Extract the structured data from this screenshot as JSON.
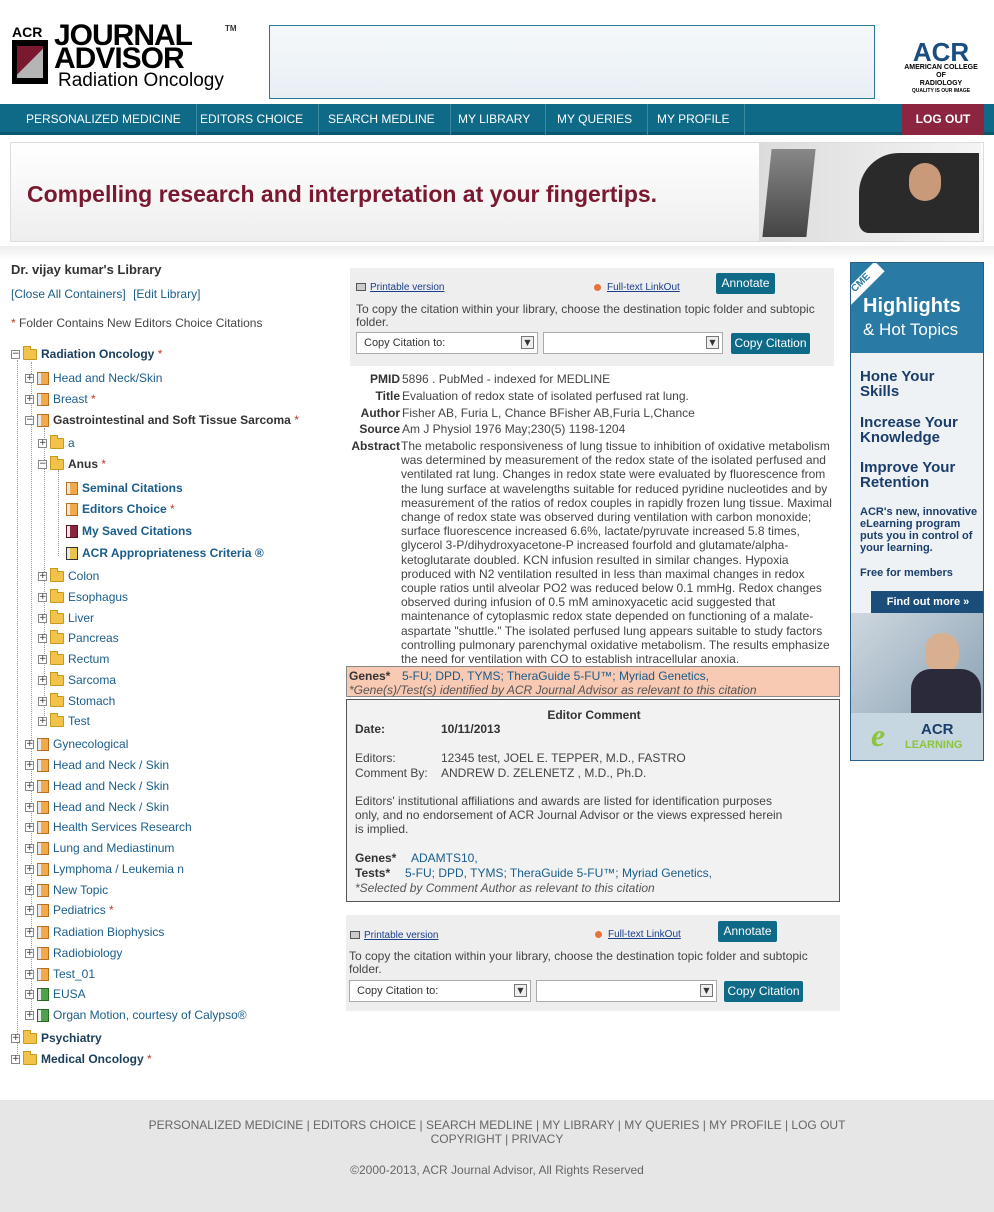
{
  "header": {
    "logo_acr": "ACR",
    "logo_line1": "JOURNAL",
    "logo_line2": "ADVISOR",
    "logo_tm": "TM",
    "logo_sub": "Radiation Oncology",
    "brand_big": "ACR",
    "brand_small_1": "AMERICAN COLLEGE OF",
    "brand_small_2": "RADIOLOGY",
    "brand_small_3": "QUALITY IS OUR IMAGE"
  },
  "nav": {
    "items": [
      "PERSONALIZED MEDICINE",
      "EDITORS CHOICE",
      "SEARCH MEDLINE",
      "MY LIBRARY",
      "MY QUERIES",
      "MY PROFILE"
    ],
    "logout": "LOG OUT"
  },
  "hero": {
    "text": "Compelling research and interpretation at your fingertips."
  },
  "library": {
    "title": "Dr. vijay kumar's Library",
    "close_all": "[Close All Containers]",
    "edit": "[Edit Library]",
    "note": "Folder Contains New Editors Choice Citations",
    "star": "*",
    "tree": {
      "root": "Radiation Oncology",
      "head_neck_skin": "Head and Neck/Skin",
      "breast": "Breast",
      "gi": "Gastrointestinal and Soft Tissue Sarcoma",
      "a": "a",
      "anus": "Anus",
      "seminal": "Seminal Citations",
      "editors_choice": "Editors Choice",
      "saved": "My Saved Citations",
      "acr_criteria": "ACR Appropriateness Criteria ®",
      "colon": "Colon",
      "esophagus": "Esophagus",
      "liver": "Liver",
      "pancreas": "Pancreas",
      "rectum": "Rectum",
      "sarcoma": "Sarcoma",
      "stomach": "Stomach",
      "test": "Test",
      "gynecological": "Gynecological",
      "hn1": "Head and Neck / Skin",
      "hn2": "Head and Neck / Skin",
      "hn3": "Head and Neck / Skin",
      "hsr": "Health Services Research",
      "lung": "Lung and Mediastinum",
      "lymphoma": "Lymphoma / Leukemia n",
      "new_topic": "New Topic",
      "pediatrics": "Pediatrics",
      "rad_bio_phys": "Radiation Biophysics",
      "radiobiology": "Radiobiology",
      "test01": "Test_01",
      "eusa": "EUSA",
      "organ_motion": "Organ Motion, courtesy of Calypso®",
      "psychiatry": "Psychiatry",
      "med_onc": "Medical Oncology"
    }
  },
  "citation": {
    "printable": "Printable version",
    "fulltext": "Full-text LinkOut",
    "annotate": "Annotate",
    "copy_instruction": "To copy the citation within your library, choose the destination topic folder and subtopic folder.",
    "copy_to": "Copy Citation to:",
    "copy_button": "Copy Citation",
    "pmid_label": "PMID",
    "pmid": "5896 . PubMed - indexed for MEDLINE",
    "title_label": "Title",
    "title": "Evaluation of redox state of isolated perfused rat lung.",
    "author_label": "Author",
    "author": "Fisher AB, Furia L, Chance BFisher AB,Furia L,Chance",
    "source_label": "Source",
    "source": "Am J Physiol 1976 May;230(5) 1198-1204",
    "abstract_label": "Abstract",
    "abstract": "The metabolic responsiveness of lung tissue to inhibition of oxidative metabolism was determined by measurement of the redox state of the isolated perfused and ventilated rat lung. Changes in redox state were evaluated by fluorescence from the lung surface at wavelengths suitable for reduced pyridine nucleotides and by measurement of the ratios of redox couples in rapidly frozen lung tissue. Maximal change of redox state was observed during ventilation with carbon monoxide; surface fluorescence increased 6.6%, lactate/pyruvate increased 5.8 times, glycerol 3-P/dihydroxyacetone-P increased fourfold and glutamate/alpha-ketoglutarate doubled. KCN infusion resulted in similar changes. Hypoxia produced with N2 ventilation resulted in less than maximal changes in redox couple ratios until alveolar PO2 was reduced below 0.1 mmHg. Redox changes observed during infusion of 0.5 mM aminoxyacetic acid suggested that maintenance of cytoplasmic redox state depended on functioning of a malate-aspartate \"shuttle.\" The isolated perfused lung appears suitable to study factors controlling pulmonary parenchymal oxidative metabolism. The results emphasize the need for ventilation with CO to establish intracellular anoxia.",
    "genes_label": "Genes*",
    "genes": "5-FU; DPD, TYMS; TheraGuide 5-FU™; Myriad Genetics,",
    "genes_note": "*Gene(s)/Test(s) identified by ACR Journal Advisor as relevant to this citation"
  },
  "editor_comment": {
    "title": "Editor Comment",
    "date_label": "Date:",
    "date": "10/11/2013",
    "editors_label": "Editors:",
    "editors": "12345 test, JOEL E. TEPPER, M.D., FASTRO",
    "comment_by_label": "Comment By:",
    "comment_by": "ANDREW D. ZELENETZ , M.D., Ph.D.",
    "disclaimer": "Editors' institutional affiliations and awards are listed for identification purposes only, and no endorsement of ACR Journal Advisor or the views expressed herein is implied.",
    "genes_label": "Genes*",
    "genes": "ADAMTS10,",
    "tests_label": "Tests*",
    "tests": "5-FU; DPD, TYMS; TheraGuide 5-FU™; Myriad Genetics,",
    "note": "*Selected by Comment Author as relevant to this citation"
  },
  "ad": {
    "cme": "CME",
    "h1": "Highlights",
    "h2": "& Hot Topics",
    "item1": "Hone Your Skills",
    "item2": "Increase Your Knowledge",
    "item3": "Improve Your Retention",
    "body": "ACR's new, innovative eLearning program puts you in control of your learning.",
    "free": "Free for members",
    "find": "Find out more »",
    "el_e": "e",
    "el_acr": "ACR",
    "el_learning": "LEARNING"
  },
  "footer": {
    "links": "PERSONALIZED MEDICINE | EDITORS CHOICE | SEARCH MEDLINE | MY LIBRARY | MY QUERIES | MY PROFILE | LOG OUT",
    "links2": "COPYRIGHT | PRIVACY",
    "copyright": "©2000-2013, ACR Journal Advisor, All Rights Reserved"
  },
  "colors": {
    "nav": "#0f6a88",
    "logout": "#8b2540",
    "hero_text": "#7a1830",
    "link": "#1a5d8a",
    "genes_bg": "#f8c9b3"
  }
}
